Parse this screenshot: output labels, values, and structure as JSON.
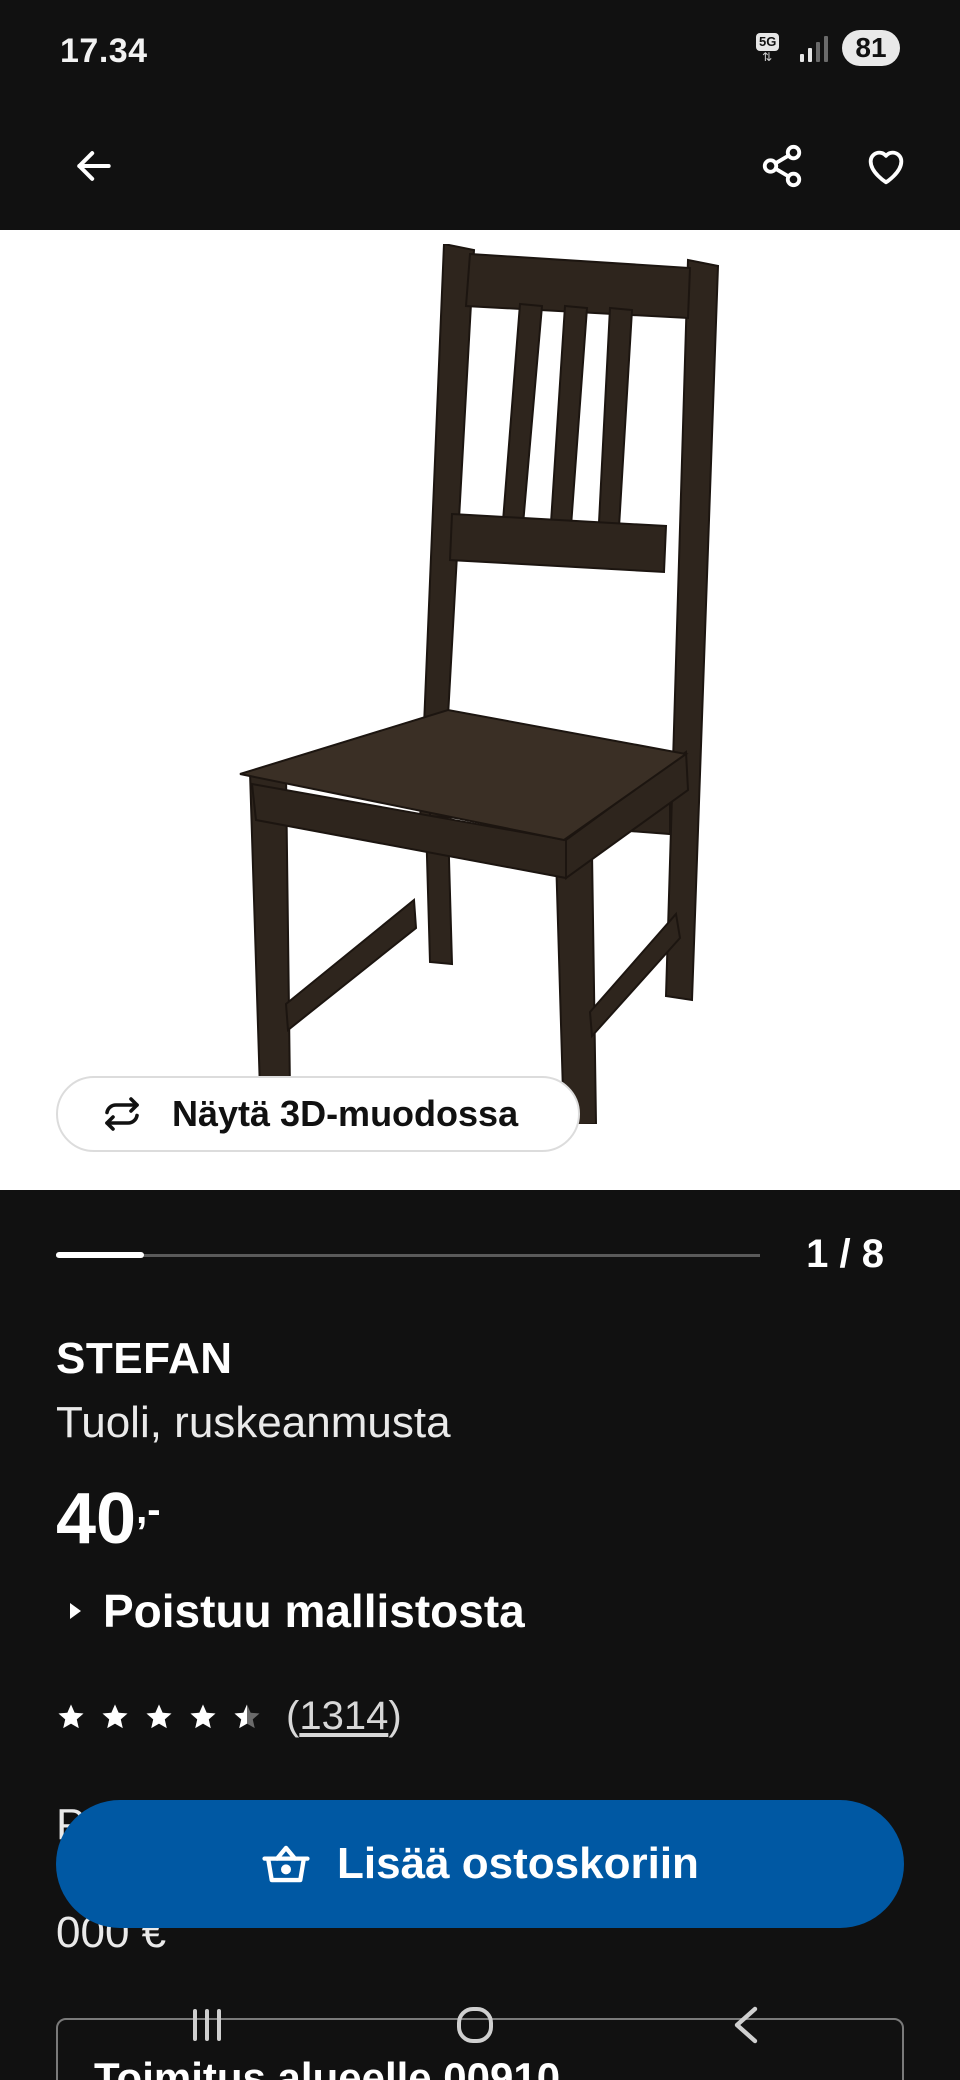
{
  "status_bar": {
    "time": "17.34",
    "network": "5G",
    "battery": "81"
  },
  "app_bar": {
    "icons": {
      "back": "arrow-left",
      "share": "share",
      "favorite": "heart"
    }
  },
  "hero": {
    "view3d_label": "Näytä 3D-muodossa"
  },
  "carousel": {
    "current": 1,
    "total": 8,
    "counter_text": "1 / 8"
  },
  "product": {
    "name": "STEFAN",
    "description": "Tuoli, ruskeanmusta",
    "price": "40",
    "price_suffix": ",-",
    "status": "Poistuu mallistosta",
    "rating": 4.5,
    "rating_max": 5,
    "review_count": "1314",
    "partial_line_1": "P",
    "partial_line_2": "000 €"
  },
  "actions": {
    "add_to_cart_label": "Lisää ostoskoriin"
  },
  "delivery": {
    "title": "Toimitus alueelle 00910"
  },
  "colors": {
    "background": "#111111",
    "accent": "#0058a3",
    "image_background": "#ffffff",
    "chair": "#2e251d"
  }
}
